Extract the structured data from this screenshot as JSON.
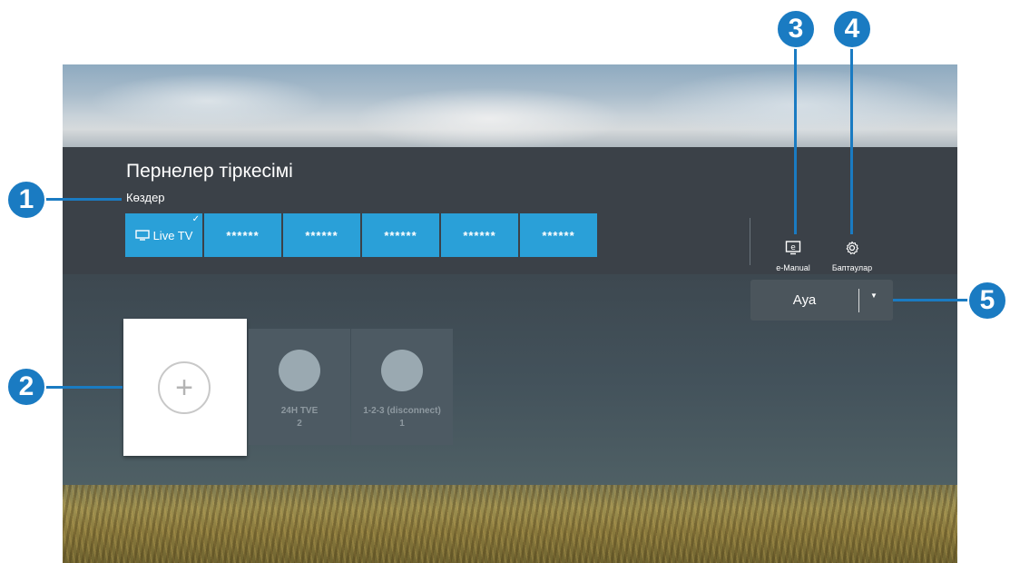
{
  "header": {
    "title": "Пернелер тіркесімі",
    "subtitle": "Көздер"
  },
  "sources": [
    {
      "label": "Live TV",
      "icon": "tv-icon",
      "selected": true
    },
    {
      "label": "******"
    },
    {
      "label": "******"
    },
    {
      "label": "******"
    },
    {
      "label": "******"
    },
    {
      "label": "******"
    }
  ],
  "shortcuts": {
    "emanual": {
      "label": "e-Manual",
      "icon": "e-manual-icon"
    },
    "settings": {
      "label": "Баптаулар",
      "icon": "gear-icon"
    }
  },
  "filter": {
    "value": "Ауа",
    "icon": "chevron-down-icon"
  },
  "apps": [
    {
      "label": "24H TVE\n2"
    },
    {
      "label": "1-2-3 (disconnect)\n1"
    }
  ],
  "callouts": [
    "1",
    "2",
    "3",
    "4",
    "5"
  ],
  "colors": {
    "accent": "#2aa0d8",
    "callout": "#1a7bc2"
  }
}
